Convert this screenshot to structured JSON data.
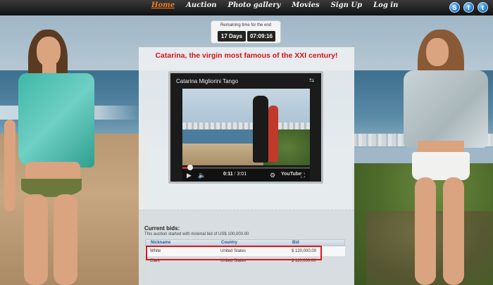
{
  "nav": {
    "items": [
      {
        "label": "Home",
        "active": true
      },
      {
        "label": "Auction"
      },
      {
        "label": "Photo gallery"
      },
      {
        "label": "Movies"
      },
      {
        "label": "Sign Up"
      },
      {
        "label": "Log in"
      }
    ],
    "social": [
      {
        "icon": "skype-icon",
        "glyph": "S"
      },
      {
        "icon": "facebook-icon",
        "glyph": "f"
      },
      {
        "icon": "twitter-icon",
        "glyph": "t"
      }
    ]
  },
  "timer": {
    "label": "Remaining time for the end",
    "days": "17 Days",
    "clock": "07:09:16"
  },
  "headline": "Catarina, the virgin most famous of the XXI century!",
  "video": {
    "title": "Catarina Migliorini Tango",
    "current_time": "0:11",
    "duration": "3:01",
    "progress_fraction": 0.061,
    "brand": "YouTube"
  },
  "bids": {
    "title": "Current bids:",
    "note": "This auction started with minimal bid of US$ 100,000.00",
    "columns": [
      "Nickname",
      "Country",
      "Bid"
    ],
    "rows": [
      {
        "nickname": "White",
        "country": "United States",
        "bid": "$ 120,000.00"
      },
      {
        "nickname": "Clark",
        "country": "United States",
        "bid": "$ 110,000.00"
      }
    ]
  },
  "colors": {
    "headline": "#d6131a",
    "nav_active": "#f08020",
    "highlight_border": "#e0141c"
  }
}
